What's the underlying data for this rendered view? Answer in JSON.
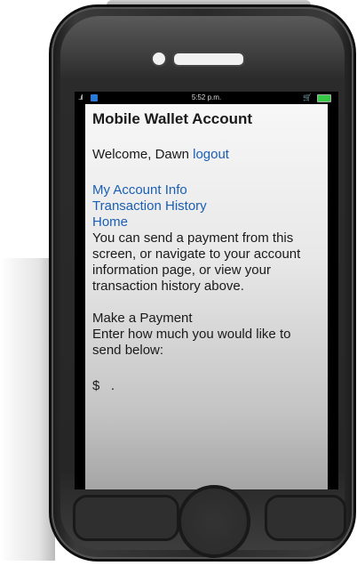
{
  "status_bar": {
    "time": "5:52 p.m.",
    "signal": "..ıl",
    "cart_icon": "cart-icon",
    "battery_icon": "battery-icon"
  },
  "app": {
    "title": "Mobile Wallet Account",
    "welcome_text": "Welcome, Dawn",
    "logout_label": "logout",
    "nav": [
      {
        "label": "My Account Info"
      },
      {
        "label": "Transaction History"
      },
      {
        "label": "Home"
      }
    ],
    "description": "You can send a payment from this screen, or navigate to your account information page, or view your transaction history above.",
    "payment_heading": "Make a Payment",
    "payment_instructions": "Enter how much you would like to send below:",
    "currency_symbol": "$",
    "amount_separator": "."
  },
  "colors": {
    "link": "#1a5fb4",
    "phone_body": "#2a2a2a",
    "screen_top": "#f7f7f7",
    "screen_bottom": "#a5a5a5"
  }
}
